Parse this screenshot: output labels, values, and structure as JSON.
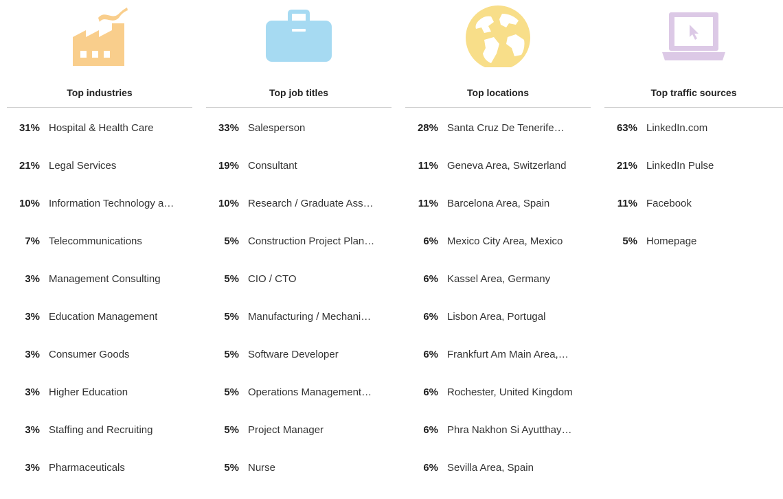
{
  "columns": [
    {
      "title": "Top industries",
      "icon": "factory-icon",
      "icon_color": "#F9CE8C",
      "rows": [
        {
          "pct": "31%",
          "name": "Hospital & Health Care"
        },
        {
          "pct": "21%",
          "name": "Legal Services"
        },
        {
          "pct": "10%",
          "name": "Information Technology a…"
        },
        {
          "pct": "7%",
          "name": "Telecommunications"
        },
        {
          "pct": "3%",
          "name": "Management Consulting"
        },
        {
          "pct": "3%",
          "name": "Education Management"
        },
        {
          "pct": "3%",
          "name": "Consumer Goods"
        },
        {
          "pct": "3%",
          "name": "Higher Education"
        },
        {
          "pct": "3%",
          "name": "Staffing and Recruiting"
        },
        {
          "pct": "3%",
          "name": "Pharmaceuticals"
        }
      ]
    },
    {
      "title": "Top job titles",
      "icon": "briefcase-icon",
      "icon_color": "#A6DAF2",
      "rows": [
        {
          "pct": "33%",
          "name": "Salesperson"
        },
        {
          "pct": "19%",
          "name": "Consultant"
        },
        {
          "pct": "10%",
          "name": "Research / Graduate Ass…"
        },
        {
          "pct": "5%",
          "name": "Construction Project Plan…"
        },
        {
          "pct": "5%",
          "name": "CIO / CTO"
        },
        {
          "pct": "5%",
          "name": "Manufacturing / Mechani…"
        },
        {
          "pct": "5%",
          "name": "Software Developer"
        },
        {
          "pct": "5%",
          "name": "Operations Management…"
        },
        {
          "pct": "5%",
          "name": "Project Manager"
        },
        {
          "pct": "5%",
          "name": "Nurse"
        }
      ]
    },
    {
      "title": "Top locations",
      "icon": "globe-icon",
      "icon_color": "#F8DE89",
      "rows": [
        {
          "pct": "28%",
          "name": "Santa Cruz De Tenerife…"
        },
        {
          "pct": "11%",
          "name": "Geneva Area, Switzerland"
        },
        {
          "pct": "11%",
          "name": "Barcelona Area, Spain"
        },
        {
          "pct": "6%",
          "name": "Mexico City Area, Mexico"
        },
        {
          "pct": "6%",
          "name": "Kassel Area, Germany"
        },
        {
          "pct": "6%",
          "name": "Lisbon Area, Portugal"
        },
        {
          "pct": "6%",
          "name": "Frankfurt Am Main Area,…"
        },
        {
          "pct": "6%",
          "name": "Rochester, United Kingdom"
        },
        {
          "pct": "6%",
          "name": "Phra Nakhon Si Ayutthay…"
        },
        {
          "pct": "6%",
          "name": "Sevilla Area, Spain"
        }
      ]
    },
    {
      "title": "Top traffic sources",
      "icon": "laptop-cursor-icon",
      "icon_color": "#DCC9E6",
      "rows": [
        {
          "pct": "63%",
          "name": "LinkedIn.com"
        },
        {
          "pct": "21%",
          "name": "LinkedIn Pulse"
        },
        {
          "pct": "11%",
          "name": "Facebook"
        },
        {
          "pct": "5%",
          "name": "Homepage"
        }
      ]
    }
  ]
}
